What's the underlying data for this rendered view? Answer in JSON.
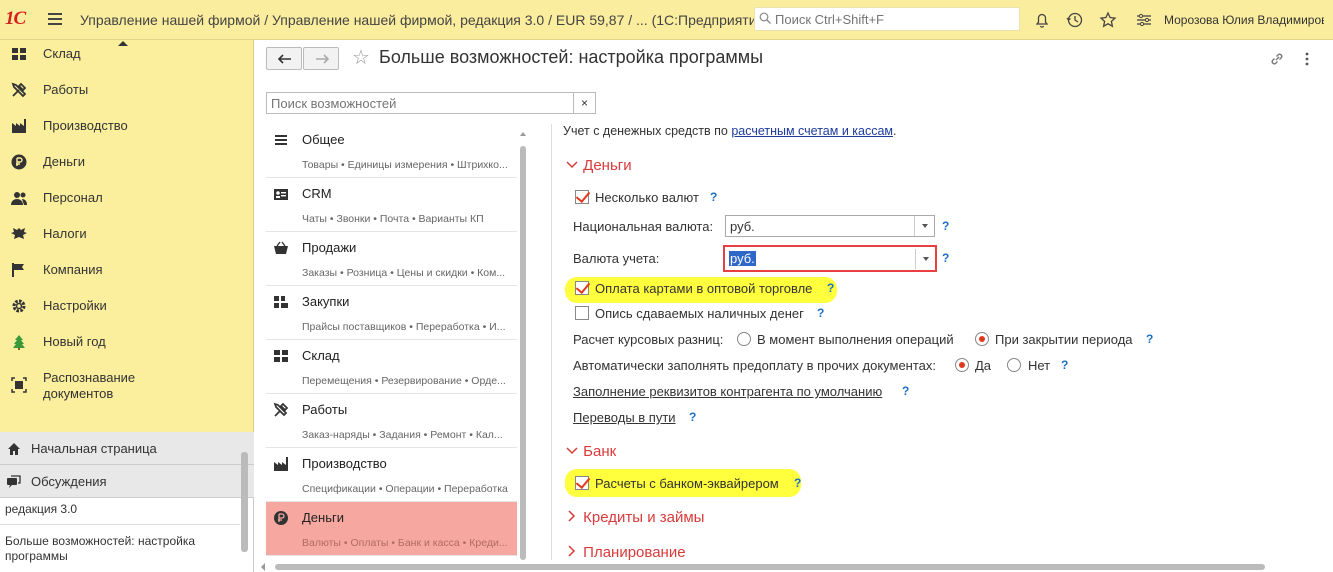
{
  "topbar": {
    "logo": "1С",
    "title": "Управление нашей фирмой / Управление нашей фирмой, редакция 3.0 / EUR 59,87 / ...  (1С:Предприятие)",
    "search_placeholder": "Поиск Ctrl+Shift+F",
    "user": "Морозова Юлия Владимиров..."
  },
  "sidebar": {
    "items": [
      {
        "label": "Склад",
        "icon": "warehouse-icon"
      },
      {
        "label": "Работы",
        "icon": "tools-icon"
      },
      {
        "label": "Производство",
        "icon": "factory-icon"
      },
      {
        "label": "Деньги",
        "icon": "ruble-icon"
      },
      {
        "label": "Персонал",
        "icon": "people-icon"
      },
      {
        "label": "Налоги",
        "icon": "eagle-icon"
      },
      {
        "label": "Компания",
        "icon": "flag-icon"
      },
      {
        "label": "Настройки",
        "icon": "gear-icon"
      },
      {
        "label": "Новый год",
        "icon": "tree-icon"
      },
      {
        "label": "Распознавание документов",
        "icon": "scan-icon"
      }
    ],
    "nav": [
      {
        "label": "Начальная страница"
      },
      {
        "label": "Обсуждения"
      }
    ],
    "open_windows": [
      "редакция 3.0",
      "Больше возможностей: настройка программы"
    ]
  },
  "form": {
    "title": "Больше возможностей: настройка программы",
    "search_placeholder": "Поиск возможностей",
    "clear": "×"
  },
  "sections": [
    {
      "title": "Общее",
      "sub": "Товары • Единицы измерения • Штрихко..."
    },
    {
      "title": "CRM",
      "sub": "Чаты • Звонки • Почта • Варианты КП"
    },
    {
      "title": "Продажи",
      "sub": "Заказы • Розница • Цены и скидки • Ком..."
    },
    {
      "title": "Закупки",
      "sub": "Прайсы поставщиков • Переработка • И..."
    },
    {
      "title": "Склад",
      "sub": "Перемещения • Резервирование • Орде..."
    },
    {
      "title": "Работы",
      "sub": "Заказ-наряды • Задания • Ремонт • Кал..."
    },
    {
      "title": "Производство",
      "sub": "Спецификации • Операции • Переработка"
    },
    {
      "title": "Деньги",
      "sub": "Валюты • Оплаты • Банк и касса • Креди..."
    }
  ],
  "settings": {
    "intro_text": "Учет с денежных средств по ",
    "intro_link": "расчетным счетам и кассам",
    "intro_end": ".",
    "money_header": "Деньги",
    "multi_currency": "Несколько валют",
    "national_currency_label": "Национальная валюта:",
    "national_currency_value": "руб.",
    "accounting_currency_label": "Валюта учета:",
    "accounting_currency_value": "руб.",
    "card_payments": "Оплата картами в оптовой торговле",
    "cash_inventory": "Опись сдаваемых наличных денег",
    "exchange_label": "Расчет курсовых разниц:",
    "exchange_opt1": "В момент выполнения операций",
    "exchange_opt2": "При закрытии периода",
    "prepay_label": "Автоматически заполнять предоплату в прочих документах:",
    "prepay_yes": "Да",
    "prepay_no": "Нет",
    "counterparty_link": "Заполнение реквизитов контрагента по умолчанию",
    "transfers_link": "Переводы в пути",
    "bank_header": "Банк",
    "acquirer": "Расчеты с банком-эквайрером",
    "credits_header": "Кредиты и займы",
    "planning_header": "Планирование",
    "help": "?"
  },
  "colors": {
    "topbar": "#fbed9e",
    "accent": "#d93a3a",
    "active_section": "#f5a7a0",
    "highlight": "#ffff33",
    "link": "#1d3c9c"
  }
}
